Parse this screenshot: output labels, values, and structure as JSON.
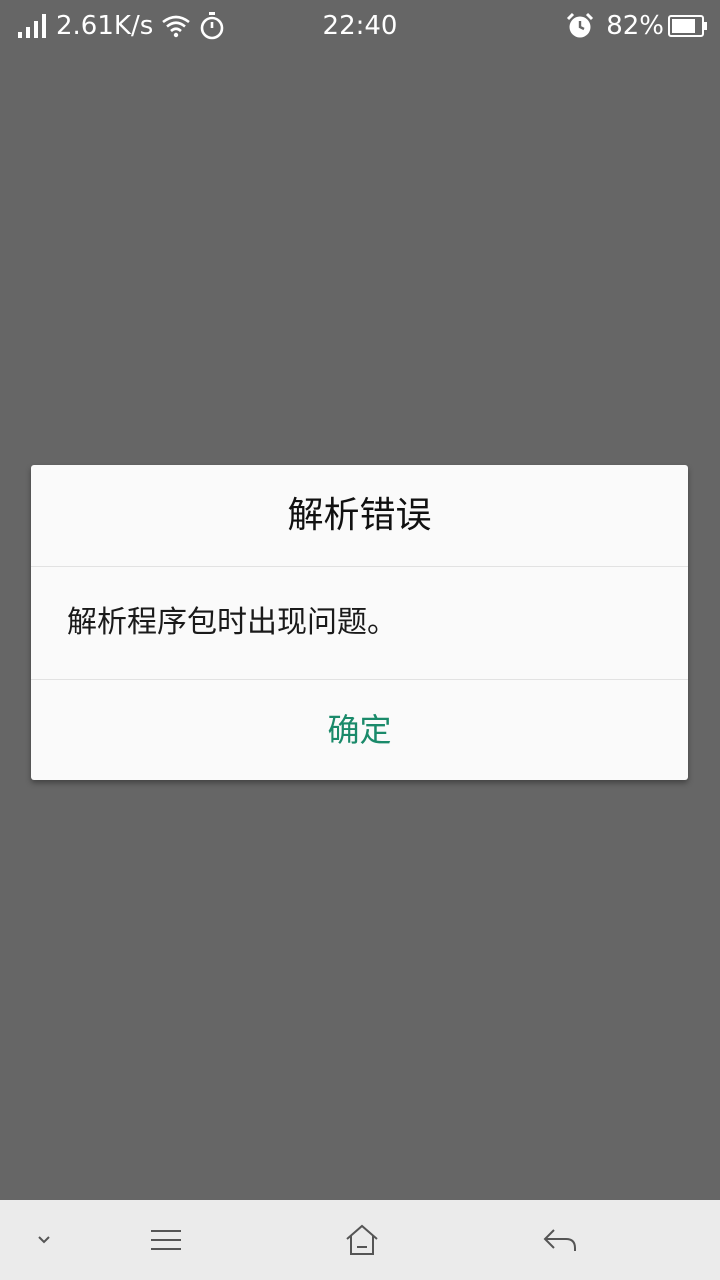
{
  "status_bar": {
    "network_speed": "2.61K/s",
    "time": "22:40",
    "battery_percent": "82%",
    "battery_level": 0.82,
    "icons": [
      "signal-icon",
      "wifi-icon",
      "timer-icon",
      "alarm-icon",
      "battery-icon"
    ]
  },
  "dialog": {
    "title": "解析错误",
    "message": "解析程序包时出现问题。",
    "confirm_label": "确定"
  },
  "nav_bar": {
    "icons": [
      "collapse-chevron-icon",
      "menu-icon",
      "home-icon",
      "back-icon"
    ]
  },
  "colors": {
    "background_dim": "#666666",
    "dialog_bg": "#fafafa",
    "accent": "#1a8a6a",
    "nav_bg": "#ebebeb"
  }
}
